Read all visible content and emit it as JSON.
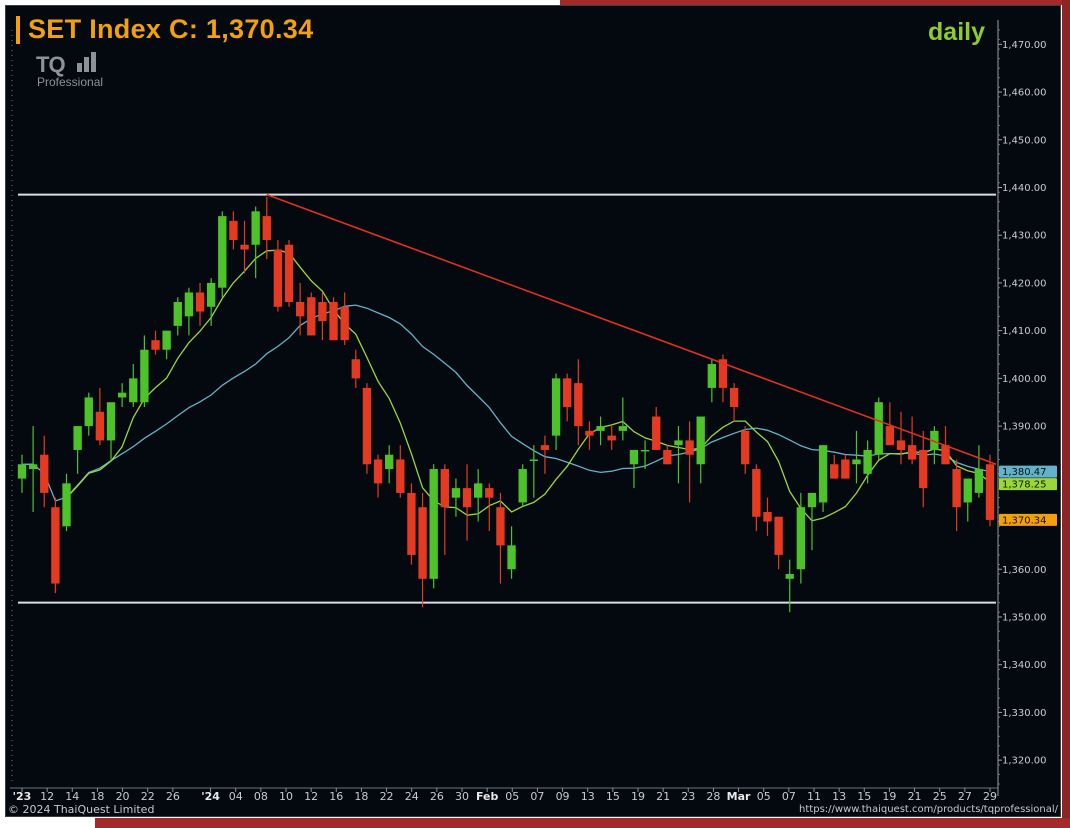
{
  "header": {
    "title": "SET Index C: 1,370.34",
    "period": "daily",
    "logo_mark": "TQ",
    "logo_sub": "Professional"
  },
  "footer": {
    "copyright": "© 2024 ThaiQuest Limited",
    "url": "https://www.thaiquest.com/products/tqprofessional/"
  },
  "colors": {
    "up": "#4dc22a",
    "down": "#e53a22",
    "ma_fast": "#9ad63a",
    "ma_slow": "#63b2c9",
    "trendline": "#e0301e",
    "support_resistance": "#dcdfe3",
    "close_tag": "#f2a10c",
    "background": "#04090f"
  },
  "chart_data": {
    "type": "candlestick",
    "title": "SET Index C: 1,370.34",
    "period": "daily",
    "ylim": [
      1315,
      1473
    ],
    "yticks": [
      1320,
      1330,
      1340,
      1350,
      1360,
      1370,
      1380,
      1390,
      1400,
      1410,
      1420,
      1430,
      1440,
      1450,
      1460,
      1470
    ],
    "ytick_labels": [
      "1,320.00",
      "1,330.00",
      "1,340.00",
      "1,350.00",
      "1,360.00",
      "1,370.00",
      "1,380.00",
      "1,390.00",
      "1,400.00",
      "1,410.00",
      "1,420.00",
      "1,430.00",
      "1,440.00",
      "1,450.00",
      "1,460.00",
      "1,470.00"
    ],
    "x_labels": [
      "'23",
      "12",
      "14",
      "18",
      "20",
      "22",
      "26",
      "'24",
      "04",
      "08",
      "10",
      "12",
      "16",
      "18",
      "22",
      "24",
      "26",
      "30",
      "Feb",
      "05",
      "07",
      "09",
      "13",
      "15",
      "19",
      "21",
      "23",
      "28",
      "Mar",
      "05",
      "07",
      "11",
      "13",
      "15",
      "19",
      "21",
      "25",
      "27",
      "29"
    ],
    "x_label_index": [
      0,
      2,
      4,
      6,
      8,
      10,
      12,
      15,
      17,
      19,
      21,
      23,
      25,
      27,
      29,
      31,
      33,
      35,
      37,
      39,
      41,
      43,
      45,
      47,
      49,
      51,
      53,
      55,
      57,
      59,
      61,
      63,
      65,
      67,
      69,
      71,
      73,
      75,
      77
    ],
    "candles": [
      {
        "o": 1379,
        "h": 1384,
        "l": 1376,
        "c": 1382
      },
      {
        "o": 1381,
        "h": 1390,
        "l": 1372,
        "c": 1382
      },
      {
        "o": 1384,
        "h": 1388,
        "l": 1373,
        "c": 1376
      },
      {
        "o": 1373,
        "h": 1375,
        "l": 1355,
        "c": 1357
      },
      {
        "o": 1369,
        "h": 1380,
        "l": 1368,
        "c": 1378
      },
      {
        "o": 1385,
        "h": 1390,
        "l": 1380,
        "c": 1390
      },
      {
        "o": 1390,
        "h": 1397,
        "l": 1388,
        "c": 1396
      },
      {
        "o": 1393,
        "h": 1398,
        "l": 1386,
        "c": 1387
      },
      {
        "o": 1387,
        "h": 1394,
        "l": 1383,
        "c": 1395
      },
      {
        "o": 1396,
        "h": 1399,
        "l": 1394,
        "c": 1397
      },
      {
        "o": 1395,
        "h": 1403,
        "l": 1394,
        "c": 1400
      },
      {
        "o": 1395,
        "h": 1409,
        "l": 1394,
        "c": 1406
      },
      {
        "o": 1408,
        "h": 1410,
        "l": 1405,
        "c": 1406
      },
      {
        "o": 1406,
        "h": 1410,
        "l": 1404,
        "c": 1410
      },
      {
        "o": 1411,
        "h": 1417,
        "l": 1409,
        "c": 1416
      },
      {
        "o": 1413,
        "h": 1419,
        "l": 1409,
        "c": 1418
      },
      {
        "o": 1418,
        "h": 1420,
        "l": 1411,
        "c": 1414
      },
      {
        "o": 1415,
        "h": 1421,
        "l": 1411,
        "c": 1420
      },
      {
        "o": 1419,
        "h": 1435,
        "l": 1417,
        "c": 1434
      },
      {
        "o": 1433,
        "h": 1435,
        "l": 1427,
        "c": 1429
      },
      {
        "o": 1428,
        "h": 1433,
        "l": 1422,
        "c": 1427
      },
      {
        "o": 1428,
        "h": 1436,
        "l": 1421,
        "c": 1435
      },
      {
        "o": 1434,
        "h": 1438,
        "l": 1425,
        "c": 1429
      },
      {
        "o": 1427,
        "h": 1429,
        "l": 1414,
        "c": 1415
      },
      {
        "o": 1428,
        "h": 1429,
        "l": 1415,
        "c": 1416
      },
      {
        "o": 1416,
        "h": 1420,
        "l": 1409,
        "c": 1413
      },
      {
        "o": 1417,
        "h": 1418,
        "l": 1409,
        "c": 1409
      },
      {
        "o": 1416,
        "h": 1418,
        "l": 1408,
        "c": 1412
      },
      {
        "o": 1416,
        "h": 1417,
        "l": 1408,
        "c": 1408
      },
      {
        "o": 1415,
        "h": 1418,
        "l": 1407,
        "c": 1408
      },
      {
        "o": 1404,
        "h": 1406,
        "l": 1398,
        "c": 1400
      },
      {
        "o": 1398,
        "h": 1399,
        "l": 1380,
        "c": 1382
      },
      {
        "o": 1383,
        "h": 1384,
        "l": 1375,
        "c": 1378
      },
      {
        "o": 1381,
        "h": 1386,
        "l": 1378,
        "c": 1384
      },
      {
        "o": 1383,
        "h": 1386,
        "l": 1375,
        "c": 1376
      },
      {
        "o": 1376,
        "h": 1378,
        "l": 1361,
        "c": 1363
      },
      {
        "o": 1373,
        "h": 1376,
        "l": 1352,
        "c": 1358
      },
      {
        "o": 1358,
        "h": 1382,
        "l": 1356,
        "c": 1381
      },
      {
        "o": 1381,
        "h": 1382,
        "l": 1363,
        "c": 1373
      },
      {
        "o": 1375,
        "h": 1379,
        "l": 1371,
        "c": 1377
      },
      {
        "o": 1377,
        "h": 1382,
        "l": 1366,
        "c": 1373
      },
      {
        "o": 1375,
        "h": 1381,
        "l": 1370,
        "c": 1378
      },
      {
        "o": 1377,
        "h": 1378,
        "l": 1368,
        "c": 1375
      },
      {
        "o": 1373,
        "h": 1376,
        "l": 1357,
        "c": 1365
      },
      {
        "o": 1360,
        "h": 1369,
        "l": 1358,
        "c": 1365
      },
      {
        "o": 1374,
        "h": 1382,
        "l": 1373,
        "c": 1381
      },
      {
        "o": 1383,
        "h": 1386,
        "l": 1375,
        "c": 1383
      },
      {
        "o": 1386,
        "h": 1388,
        "l": 1380,
        "c": 1385
      },
      {
        "o": 1388,
        "h": 1401,
        "l": 1385,
        "c": 1400
      },
      {
        "o": 1400,
        "h": 1401,
        "l": 1391,
        "c": 1394
      },
      {
        "o": 1399,
        "h": 1404,
        "l": 1386,
        "c": 1390
      },
      {
        "o": 1389,
        "h": 1391,
        "l": 1385,
        "c": 1388
      },
      {
        "o": 1389,
        "h": 1392,
        "l": 1386,
        "c": 1390
      },
      {
        "o": 1388,
        "h": 1390,
        "l": 1385,
        "c": 1387
      },
      {
        "o": 1389,
        "h": 1396,
        "l": 1387,
        "c": 1390
      },
      {
        "o": 1382,
        "h": 1385,
        "l": 1377,
        "c": 1385
      },
      {
        "o": 1385,
        "h": 1387,
        "l": 1381,
        "c": 1385
      },
      {
        "o": 1392,
        "h": 1394,
        "l": 1387,
        "c": 1385
      },
      {
        "o": 1385,
        "h": 1386,
        "l": 1382,
        "c": 1382
      },
      {
        "o": 1386,
        "h": 1390,
        "l": 1378,
        "c": 1387
      },
      {
        "o": 1387,
        "h": 1391,
        "l": 1374,
        "c": 1384
      },
      {
        "o": 1382,
        "h": 1388,
        "l": 1378,
        "c": 1392
      },
      {
        "o": 1398,
        "h": 1404,
        "l": 1395,
        "c": 1403
      },
      {
        "o": 1404,
        "h": 1405,
        "l": 1395,
        "c": 1398
      },
      {
        "o": 1398,
        "h": 1399,
        "l": 1391,
        "c": 1394
      },
      {
        "o": 1389,
        "h": 1390,
        "l": 1380,
        "c": 1382
      },
      {
        "o": 1381,
        "h": 1382,
        "l": 1368,
        "c": 1371
      },
      {
        "o": 1372,
        "h": 1375,
        "l": 1367,
        "c": 1370
      },
      {
        "o": 1371,
        "h": 1371,
        "l": 1360,
        "c": 1363
      },
      {
        "o": 1358,
        "h": 1362,
        "l": 1351,
        "c": 1359
      },
      {
        "o": 1360,
        "h": 1376,
        "l": 1357,
        "c": 1373
      },
      {
        "o": 1373,
        "h": 1375,
        "l": 1364,
        "c": 1376
      },
      {
        "o": 1374,
        "h": 1386,
        "l": 1372,
        "c": 1386
      },
      {
        "o": 1382,
        "h": 1384,
        "l": 1379,
        "c": 1379
      },
      {
        "o": 1383,
        "h": 1384,
        "l": 1379,
        "c": 1379
      },
      {
        "o": 1382,
        "h": 1389,
        "l": 1378,
        "c": 1383
      },
      {
        "o": 1380,
        "h": 1387,
        "l": 1378,
        "c": 1385
      },
      {
        "o": 1384,
        "h": 1396,
        "l": 1383,
        "c": 1395
      },
      {
        "o": 1390,
        "h": 1395,
        "l": 1386,
        "c": 1386
      },
      {
        "o": 1387,
        "h": 1393,
        "l": 1382,
        "c": 1385
      },
      {
        "o": 1386,
        "h": 1392,
        "l": 1382,
        "c": 1383
      },
      {
        "o": 1385,
        "h": 1389,
        "l": 1373,
        "c": 1377
      },
      {
        "o": 1385,
        "h": 1390,
        "l": 1382,
        "c": 1389
      },
      {
        "o": 1386,
        "h": 1390,
        "l": 1382,
        "c": 1382
      },
      {
        "o": 1381,
        "h": 1383,
        "l": 1368,
        "c": 1373
      },
      {
        "o": 1374,
        "h": 1379,
        "l": 1370,
        "c": 1379
      },
      {
        "o": 1376,
        "h": 1386,
        "l": 1375,
        "c": 1381
      },
      {
        "o": 1382,
        "h": 1384,
        "l": 1369,
        "c": 1370.34
      }
    ],
    "ma_fast_last": 1378.25,
    "ma_slow_last": 1380.47,
    "last_close": 1370.34,
    "last_labels": [
      "1,380.47",
      "1,378.25",
      "1,370.34"
    ],
    "horizontal_lines": [
      1438.5,
      1353
    ],
    "trendline": {
      "from": {
        "index": 22,
        "value": 1438.5
      },
      "to": {
        "index": 89,
        "value": 1382
      }
    },
    "grid": false
  }
}
